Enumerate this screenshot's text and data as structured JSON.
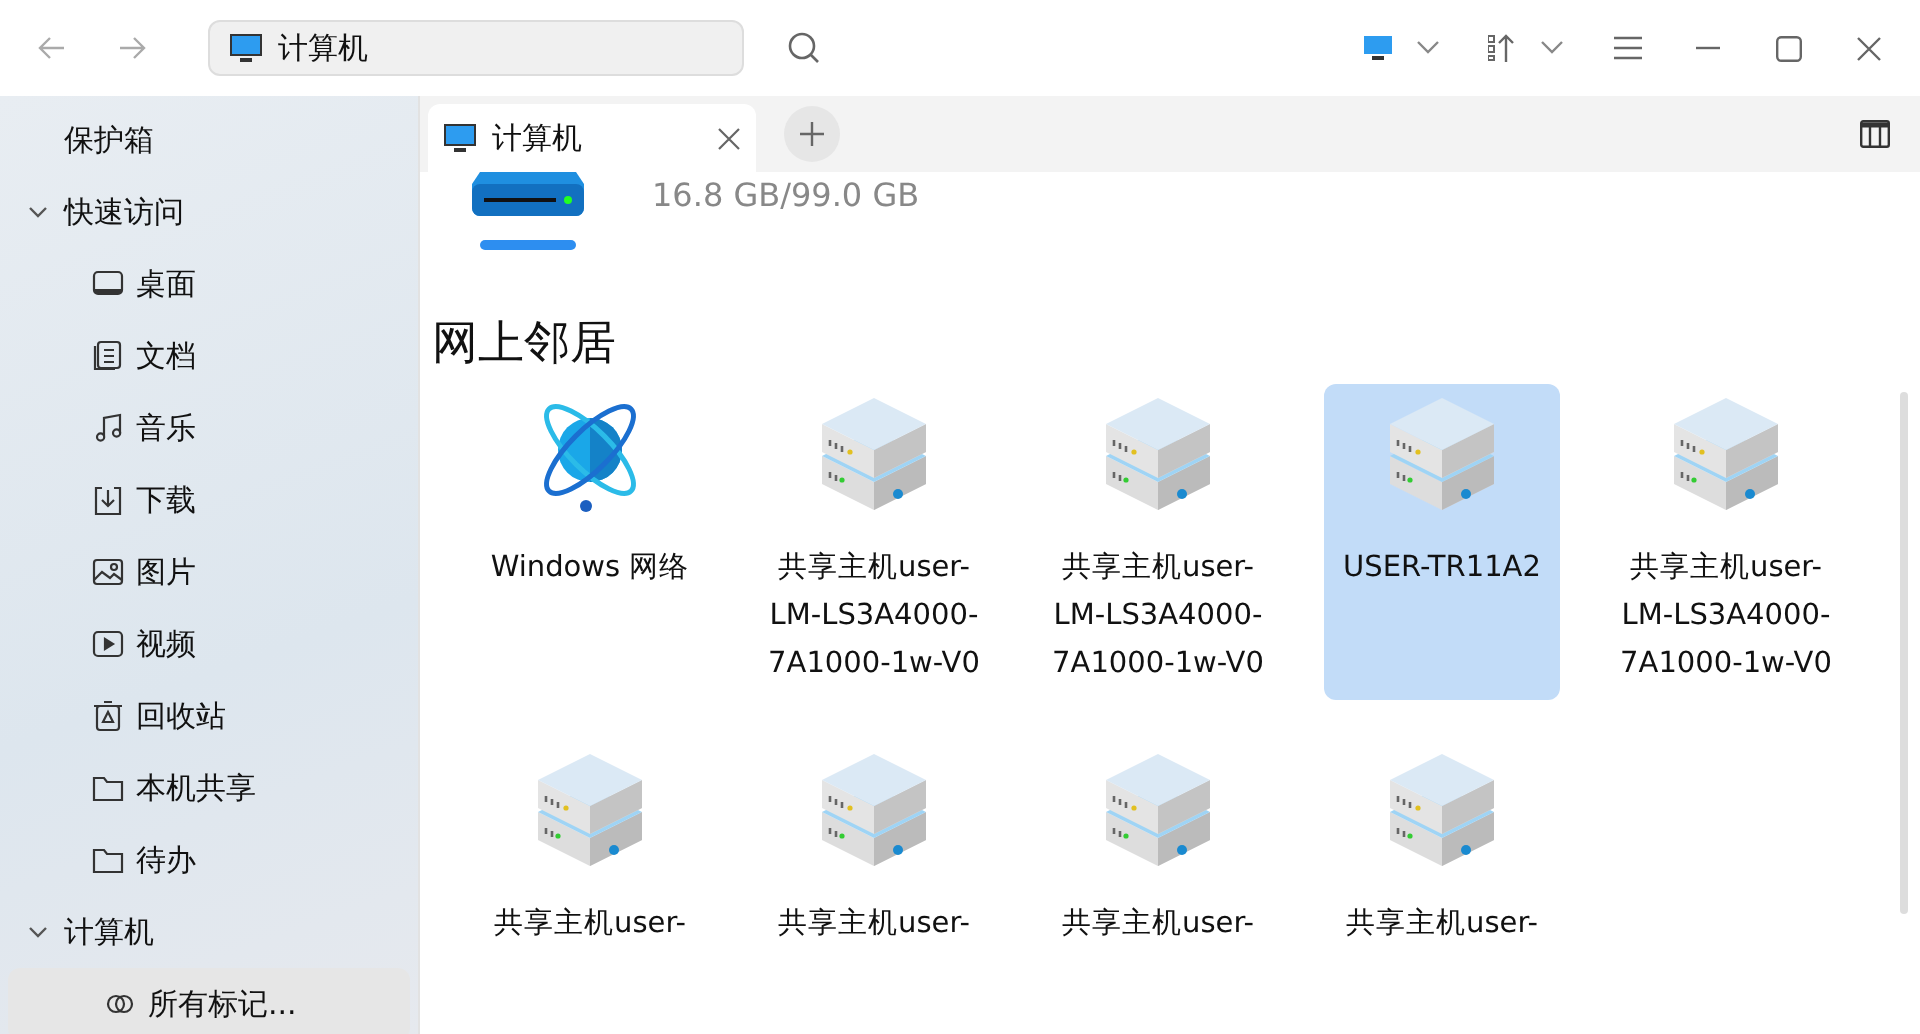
{
  "address_bar": {
    "value": "计算机"
  },
  "sidebar": {
    "items": [
      {
        "label": "保护箱",
        "kind": "plain",
        "selected": false
      },
      {
        "label": "快速访问",
        "kind": "group",
        "expanded": true,
        "children": [
          {
            "label": "桌面",
            "kind": "desktop",
            "selected": false
          },
          {
            "label": "文档",
            "kind": "document",
            "selected": false
          },
          {
            "label": "音乐",
            "kind": "music",
            "selected": false
          },
          {
            "label": "下载",
            "kind": "download",
            "selected": false
          },
          {
            "label": "图片",
            "kind": "picture",
            "selected": false
          },
          {
            "label": "视频",
            "kind": "video",
            "selected": false
          },
          {
            "label": "回收站",
            "kind": "trash",
            "selected": false
          },
          {
            "label": "本机共享",
            "kind": "folder",
            "selected": false
          },
          {
            "label": "待办",
            "kind": "folder",
            "selected": false
          }
        ]
      },
      {
        "label": "计算机",
        "kind": "group",
        "expanded": true,
        "children": [
          {
            "label": "所有标记...",
            "kind": "tag",
            "selected": true
          }
        ]
      }
    ]
  },
  "tabs": [
    {
      "label": "计算机"
    }
  ],
  "disk": {
    "usage": "16.8 GB/99.0 GB"
  },
  "section": {
    "title": "网上邻居"
  },
  "items": [
    {
      "kind": "network",
      "lines": [
        "Windows 网络"
      ],
      "selected": false
    },
    {
      "kind": "server",
      "lines": [
        "共享主机user-",
        "LM-LS3A4000-",
        "7A1000-1w-V0"
      ],
      "selected": false
    },
    {
      "kind": "server",
      "lines": [
        "共享主机user-",
        "LM-LS3A4000-",
        "7A1000-1w-V0"
      ],
      "selected": false
    },
    {
      "kind": "server",
      "lines": [
        "USER-TR11A2"
      ],
      "selected": true
    },
    {
      "kind": "server",
      "lines": [
        "共享主机user-",
        "LM-LS3A4000-",
        "7A1000-1w-V0"
      ],
      "selected": false
    },
    {
      "kind": "server",
      "lines": [
        "共享主机user-"
      ],
      "selected": false
    },
    {
      "kind": "server",
      "lines": [
        "共享主机user-"
      ],
      "selected": false
    },
    {
      "kind": "server",
      "lines": [
        "共享主机user-"
      ],
      "selected": false
    },
    {
      "kind": "server",
      "lines": [
        "共享主机user-"
      ],
      "selected": false
    }
  ]
}
